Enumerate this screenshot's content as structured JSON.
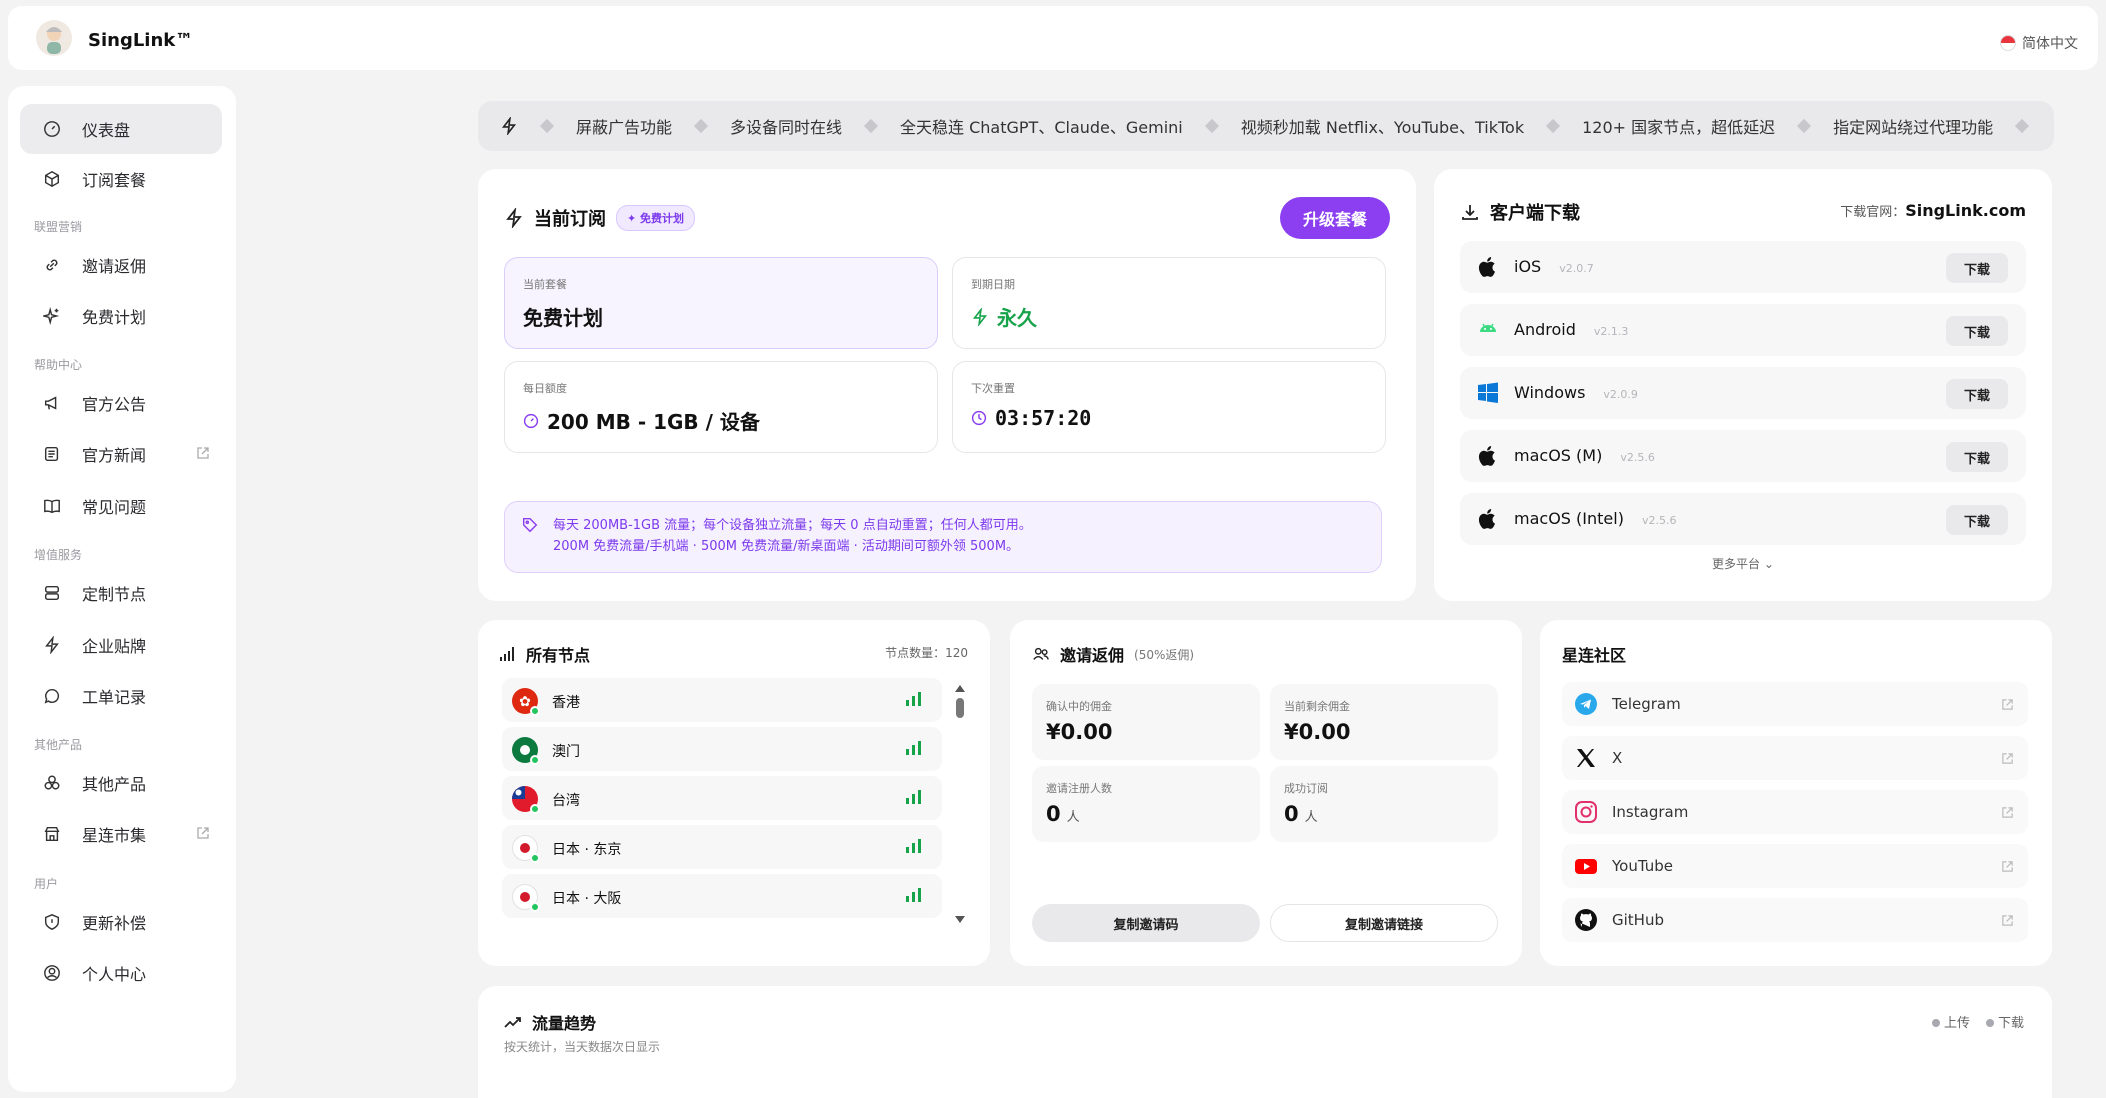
{
  "app": {
    "brand": "SingLink™",
    "language": "简体中文"
  },
  "sidebar": {
    "items": [
      {
        "label": "仪表盘"
      },
      {
        "label": "订阅套餐"
      },
      {
        "label": "邀请返佣"
      },
      {
        "label": "免费计划"
      },
      {
        "label": "官方公告"
      },
      {
        "label": "官方新闻"
      },
      {
        "label": "常见问题"
      },
      {
        "label": "定制节点"
      },
      {
        "label": "企业贴牌"
      },
      {
        "label": "工单记录"
      },
      {
        "label": "其他产品"
      },
      {
        "label": "星连市集"
      },
      {
        "label": "更新补偿"
      },
      {
        "label": "个人中心"
      }
    ],
    "groups": {
      "affiliate": "联盟营销",
      "help": "帮助中心",
      "value_added": "增值服务",
      "other": "其他产品",
      "user": "用户"
    }
  },
  "ticker": [
    "屏蔽广告功能",
    "多设备同时在线",
    "全天稳连 ChatGPT、Claude、Gemini",
    "视频秒加载 Netflix、YouTube、TikTok",
    "120+ 国家节点，超低延迟",
    "指定网站绕过代理功能"
  ],
  "subscription": {
    "title": "当前订阅",
    "badge": "免费计划",
    "upgrade_label": "升级套餐",
    "plan_label": "当前套餐",
    "plan_value": "免费计划",
    "expiry_label": "到期日期",
    "expiry_value": "永久",
    "quota_label": "每日额度",
    "quota_value": "200 MB - 1GB / 设备",
    "reset_label": "下次重置",
    "reset_value": "03:57:20",
    "note_line1": "每天 200MB-1GB 流量；每个设备独立流量；每天 0 点自动重置；任何人都可用。",
    "note_line2": "200M 免费流量/手机端 · 500M 免费流量/新桌面端 · 活动期间可额外领 500M。"
  },
  "downloads": {
    "title": "客户端下载",
    "site_label": "下载官网：",
    "site_value": "SingLink.com",
    "button_label": "下载",
    "more_label": "更多平台",
    "clients": [
      {
        "os": "iOS",
        "version": "v2.0.7"
      },
      {
        "os": "Android",
        "version": "v2.1.3"
      },
      {
        "os": "Windows",
        "version": "v2.0.9"
      },
      {
        "os": "macOS (M)",
        "version": "v2.5.6"
      },
      {
        "os": "macOS (Intel)",
        "version": "v2.5.6"
      }
    ]
  },
  "nodes": {
    "title": "所有节点",
    "count_label": "节点数量：",
    "count_value": "120",
    "items": [
      {
        "name": "香港"
      },
      {
        "name": "澳门"
      },
      {
        "name": "台湾"
      },
      {
        "name": "日本 · 东京"
      },
      {
        "name": "日本 · 大阪"
      }
    ]
  },
  "invite": {
    "title": "邀请返佣",
    "subtitle": "(50%返佣)",
    "pending_label": "确认中的佣金",
    "pending_value": "¥0.00",
    "balance_label": "当前剩余佣金",
    "balance_value": "¥0.00",
    "reg_label": "邀请注册人数",
    "reg_value": "0",
    "reg_unit": "人",
    "orders_label": "成功订阅",
    "orders_value": "0",
    "orders_unit": "人",
    "copy_code": "复制邀请码",
    "copy_link": "复制邀请链接"
  },
  "community": {
    "title": "星连社区",
    "items": [
      {
        "name": "Telegram"
      },
      {
        "name": "X"
      },
      {
        "name": "Instagram"
      },
      {
        "name": "YouTube"
      },
      {
        "name": "GitHub"
      }
    ]
  },
  "traffic": {
    "title": "流量趋势",
    "subtitle": "按天统计，当天数据次日显示",
    "legend_up": "上传",
    "legend_down": "下载"
  },
  "colors": {
    "accent": "#8b3ff0",
    "success": "#16a34a"
  }
}
